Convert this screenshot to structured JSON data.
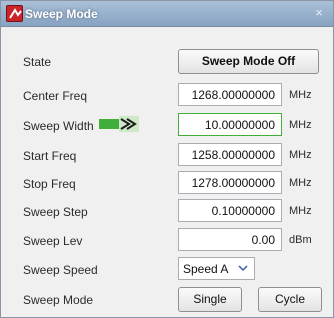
{
  "window": {
    "title": "Sweep Mode",
    "close_glyph": "×",
    "app_icon": "app-icon"
  },
  "rows": {
    "state": {
      "label": "State",
      "button": "Sweep Mode Off"
    },
    "center_freq": {
      "label": "Center Freq",
      "value": "1268.00000000",
      "unit": "MHz"
    },
    "sweep_width": {
      "label": "Sweep Width",
      "value": "10.00000000",
      "unit": "MHz"
    },
    "start_freq": {
      "label": "Start Freq",
      "value": "1258.00000000",
      "unit": "MHz"
    },
    "stop_freq": {
      "label": "Stop Freq",
      "value": "1278.00000000",
      "unit": "MHz"
    },
    "sweep_step": {
      "label": "Sweep Step",
      "value": "0.10000000",
      "unit": "MHz"
    },
    "sweep_lev": {
      "label": "Sweep Lev",
      "value": "0.00",
      "unit": "dBm"
    },
    "sweep_speed": {
      "label": "Sweep Speed",
      "selected": "Speed A"
    },
    "sweep_mode": {
      "label": "Sweep Mode",
      "single_label": "Single",
      "cycle_label": "Cycle"
    }
  },
  "icons": {
    "dropdown": "chevron-down-icon"
  },
  "colors": {
    "titlebar": "#87a3c2",
    "app_icon": "#c8242a",
    "glitch_green": "#3fae3a"
  }
}
